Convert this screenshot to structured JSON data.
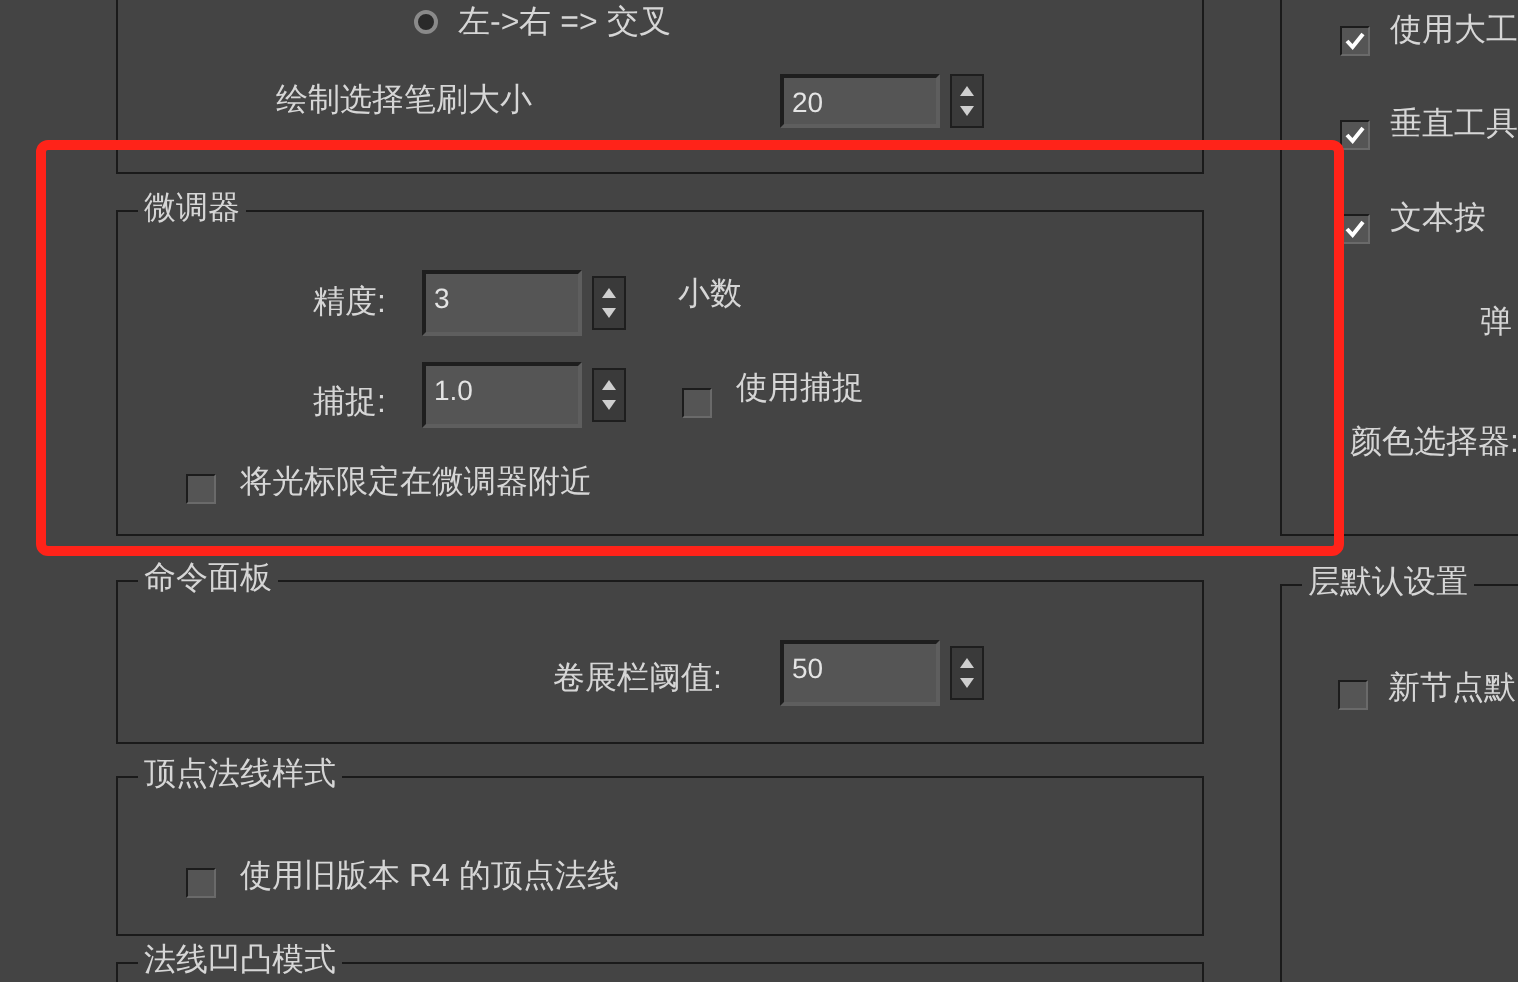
{
  "top_group": {
    "radio": {
      "label": "左->右 => 交叉",
      "selected": false
    },
    "brush_size": {
      "label": "绘制选择笔刷大小",
      "value": "20"
    }
  },
  "spinner_group": {
    "title": "微调器",
    "precision": {
      "label": "精度:",
      "value": "3",
      "unit": "小数"
    },
    "snap": {
      "label": "捕捉:",
      "value": "1.0"
    },
    "use_snap": {
      "label": "使用捕捉",
      "checked": false
    },
    "limit_cursor": {
      "label": "将光标限定在微调器附近",
      "checked": false
    }
  },
  "command_panel": {
    "title": "命令面板",
    "rollout_threshold": {
      "label": "卷展栏阈值:",
      "value": "50"
    }
  },
  "vertex_normal": {
    "title": "顶点法线样式",
    "legacy": {
      "label": "使用旧版本 R4 的顶点法线",
      "checked": false
    }
  },
  "normal_bump": {
    "title": "法线凹凸模式"
  },
  "right_top": {
    "checkboxes": [
      {
        "label": "使用大工",
        "checked": true
      },
      {
        "label": "垂直工具",
        "checked": true
      },
      {
        "label": "文本按",
        "checked": true
      }
    ],
    "popup_label": "弹",
    "color_picker_label": "颜色选择器:"
  },
  "layer_defaults": {
    "title": "层默认设置",
    "checkboxes": [
      {
        "label": "新节点默",
        "checked": false
      }
    ]
  }
}
